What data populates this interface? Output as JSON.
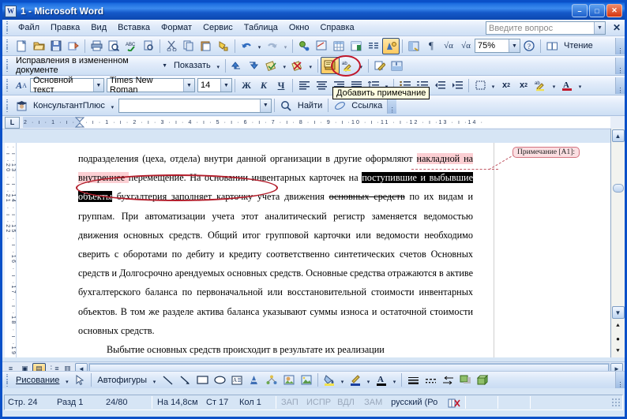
{
  "window": {
    "title": "1 - Microsoft Word",
    "app_icon": "word-document-icon",
    "minimize": "–",
    "maximize": "□",
    "close": "✕"
  },
  "menubar": {
    "items": [
      {
        "label": "Файл",
        "name": "menu-file"
      },
      {
        "label": "Правка",
        "name": "menu-edit"
      },
      {
        "label": "Вид",
        "name": "menu-view"
      },
      {
        "label": "Вставка",
        "name": "menu-insert"
      },
      {
        "label": "Формат",
        "name": "menu-format"
      },
      {
        "label": "Сервис",
        "name": "menu-tools"
      },
      {
        "label": "Таблица",
        "name": "menu-table"
      },
      {
        "label": "Окно",
        "name": "menu-window"
      },
      {
        "label": "Справка",
        "name": "menu-help"
      }
    ],
    "ask_placeholder": "Введите вопрос",
    "close_label": "✕"
  },
  "standard_toolbar": {
    "zoom_value": "75%",
    "reading_label": "Чтение",
    "buttons": [
      "new-document-icon",
      "open-folder-icon",
      "save-disk-icon",
      "email-icon",
      "print-icon",
      "print-preview-icon",
      "spelling-check-icon",
      "research-icon",
      "cut-scissors-icon",
      "copy-icon",
      "paste-icon",
      "format-painter-icon",
      "undo-icon",
      "redo-icon",
      "insert-hyperlink-icon",
      "tables-borders-icon",
      "insert-table-icon",
      "insert-excel-table-icon",
      "columns-icon",
      "drawing-icon",
      "document-map-icon",
      "show-formatting-marks-icon",
      "sqrt-alpha-icon",
      "sqrt-alpha-2-icon",
      "help-icon",
      "reading-layout-icon"
    ]
  },
  "reviewing_toolbar": {
    "display_for_review": "Исправления в измененном документе",
    "show_label": "Показать",
    "buttons": [
      "previous-change-icon",
      "next-change-icon",
      "accept-change-icon",
      "reject-change-icon",
      "new-comment-icon",
      "highlight-icon",
      "track-changes-icon",
      "reviewing-pane-icon"
    ],
    "highlighted_button": "new-comment-icon",
    "tooltip": "Добавить примечание"
  },
  "formatting_toolbar": {
    "style": "Основной текст",
    "font": "Times New Roman",
    "size": "14",
    "bold": "Ж",
    "italic": "К",
    "underline": "Ч",
    "buttons": [
      "styles-formatting-icon",
      "align-left-icon",
      "align-center-icon",
      "align-right-icon",
      "justify-icon",
      "line-spacing-icon",
      "numbering-icon",
      "bullets-icon",
      "decrease-indent-icon",
      "increase-indent-icon",
      "outside-border-icon",
      "subscript-icon",
      "superscript-icon",
      "highlight-color-icon",
      "font-color-icon"
    ]
  },
  "consultant_toolbar": {
    "label": "КонсультантПлюс",
    "search_value": "",
    "find_label": "Найти",
    "link_label": "Ссылка",
    "icons": [
      "consultant-logo-icon",
      "magnifier-icon",
      "link-icon"
    ]
  },
  "ruler": {
    "horizontal": "2 · ı · 1 · ı · ı · ı · 1 · ı · 2 · ı · 3 · ı · 4 · ı · 5 · ı · 6 · ı · 7 · ı · 8 · ı · 9 · ı ·10 · ı ·11 ·  ı ·12 · ı ·13 · ı ·14 ·",
    "vertical": "· ı ·13 · ı ·14 · ı ·15 · ı ·16 · ı ·17 · ı ·18 · ı ·19 · ı ·20 · ı ·21 · ı ·22 ·",
    "tab_stop_button": "L"
  },
  "document": {
    "paragraph_1_part_1": "подразделения (цеха, отдела) внутри данной организации в другие оформляют ",
    "paragraph_1_deleted": "накладной на внутреннее ",
    "paragraph_1_part_2": "перемещение. На основании инвентарных карточек на ",
    "paragraph_1_selected": "поступившие и выбывшие объекты",
    "paragraph_1_part_3": " бухгалтерия заполняет карточку учета ",
    "paragraph_1_part_4": "движения ",
    "paragraph_1_strike": "основных средств",
    "paragraph_1_part_5": " по их видам и группам. При автоматизации учета этот аналитический регистр заменяется ведомостью движения основных средств. Общий итог групповой карточки или ведомости необходимо сверить с оборотами по дебиту и кредиту соответственно синтетических счетов Основных средств и Долгосрочно арендуемых основных средств. Основные средства отражаются в активе бухгалтерского баланса по первоначальной или восстановительной стоимости инвентарных объектов. В том же разделе актива баланса указывают суммы износа и остаточной стоимости основных средств.",
    "paragraph_2": "Выбытие основных средств происходит в результате их реализации",
    "comment_balloon": "Примечание [A1]:",
    "highlight_color": "#fccfd3",
    "annotation_color": "#b31d2b"
  },
  "view_buttons": {
    "items": [
      {
        "name": "normal-view-button",
        "glyph": "≡"
      },
      {
        "name": "web-layout-view-button",
        "glyph": "▣"
      },
      {
        "name": "print-layout-view-button",
        "glyph": "▤"
      },
      {
        "name": "outline-view-button",
        "glyph": "⋮≡"
      },
      {
        "name": "reading-layout-view-button",
        "glyph": "▥"
      }
    ],
    "active": "print-layout-view-button"
  },
  "drawing_toolbar": {
    "menu_label": "Рисование",
    "autoshapes_label": "Автофигуры",
    "buttons": [
      "select-objects-icon",
      "line-icon",
      "arrow-icon",
      "rectangle-icon",
      "oval-icon",
      "text-box-icon",
      "word-art-icon",
      "diagram-icon",
      "clip-art-icon",
      "picture-icon",
      "fill-color-icon",
      "line-color-icon",
      "font-color-icon",
      "line-style-icon",
      "dash-style-icon",
      "arrow-style-icon",
      "shadow-style-icon",
      "3d-style-icon"
    ]
  },
  "statusbar": {
    "page": "Стр. 24",
    "section": "Разд 1",
    "pages": "24/80",
    "at": "На 14,8см",
    "line": "Ст 17",
    "column": "Кол 1",
    "rec": "ЗАП",
    "trk": "ИСПР",
    "ext": "ВДЛ",
    "ovr": "ЗАМ",
    "language": "русский (Ро",
    "spelling_icon": "spelling-status-icon"
  }
}
